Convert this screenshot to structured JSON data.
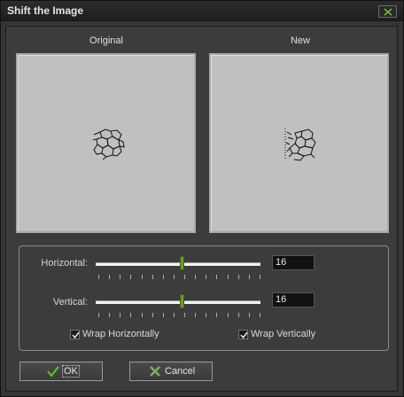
{
  "window": {
    "title": "Shift the Image",
    "close_icon": "close-icon"
  },
  "previews": {
    "original_label": "Original",
    "new_label": "New",
    "canvas_color": "#c0c0c0"
  },
  "horizontal": {
    "label": "Horizontal:",
    "value": "16",
    "slider_fraction": 0.5
  },
  "vertical": {
    "label": "Vertical:",
    "value": "16",
    "slider_fraction": 0.5
  },
  "options": {
    "wrap_horizontally": "Wrap Horizontally",
    "wrap_vertically": "Wrap Vertically",
    "wrap_horizontally_checked": true,
    "wrap_vertically_checked": true
  },
  "buttons": {
    "ok": "OK",
    "cancel": "Cancel"
  },
  "colors": {
    "accent_green": "#6f9a2a",
    "ok_check": "#5cbf2a",
    "cancel_x": "#a0a0a0"
  }
}
